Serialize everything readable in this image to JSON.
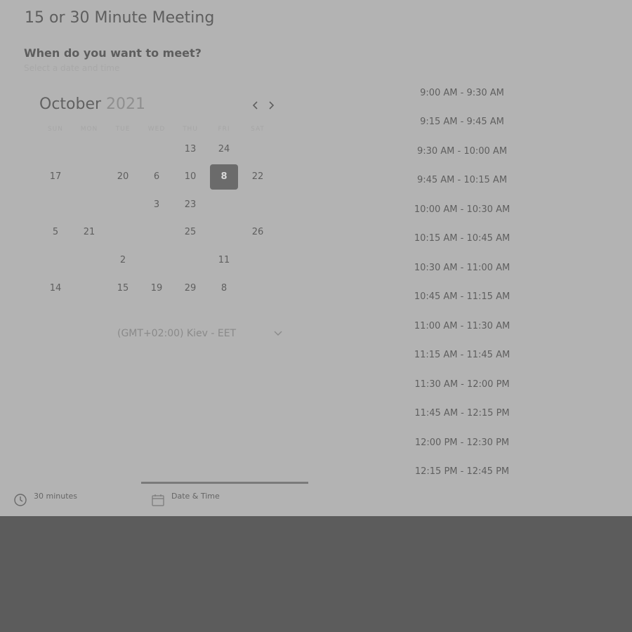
{
  "meeting": {
    "title": "15 or 30 Minute Meeting",
    "question": "When do you want to meet?",
    "hint": "Select a date and time"
  },
  "calendar": {
    "month": "October",
    "year": "2021",
    "prev_icon": "chevron-left-icon",
    "next_icon": "chevron-right-icon",
    "weekdays": [
      "SUN",
      "MON",
      "TUE",
      "WED",
      "THU",
      "FRI",
      "SAT"
    ],
    "weeks": [
      [
        {
          "t": "",
          "m": true
        },
        {
          "t": "",
          "m": true
        },
        {
          "t": "",
          "m": true
        },
        {
          "t": "",
          "m": true
        },
        {
          "t": "13",
          "m": false
        },
        {
          "t": "24",
          "m": false
        },
        {
          "t": "",
          "m": true
        }
      ],
      [
        {
          "t": "17",
          "m": false
        },
        {
          "t": "",
          "m": true
        },
        {
          "t": "20",
          "m": false
        },
        {
          "t": "6",
          "m": false
        },
        {
          "t": "10",
          "m": false
        },
        {
          "t": "8",
          "m": false,
          "selected": true
        },
        {
          "t": "22",
          "m": false
        }
      ],
      [
        {
          "t": "",
          "m": true
        },
        {
          "t": "",
          "m": true
        },
        {
          "t": "",
          "m": true
        },
        {
          "t": "3",
          "m": false
        },
        {
          "t": "23",
          "m": false
        },
        {
          "t": "",
          "m": true
        },
        {
          "t": "",
          "m": true
        }
      ],
      [
        {
          "t": "5",
          "m": false
        },
        {
          "t": "21",
          "m": false
        },
        {
          "t": "",
          "m": true
        },
        {
          "t": "",
          "m": true
        },
        {
          "t": "25",
          "m": false
        },
        {
          "t": "",
          "m": true
        },
        {
          "t": "26",
          "m": false
        }
      ],
      [
        {
          "t": "",
          "m": true
        },
        {
          "t": "",
          "m": true
        },
        {
          "t": "2",
          "m": false
        },
        {
          "t": "",
          "m": true
        },
        {
          "t": "",
          "m": true
        },
        {
          "t": "11",
          "m": false
        },
        {
          "t": "",
          "m": true
        }
      ],
      [
        {
          "t": "14",
          "m": false
        },
        {
          "t": "",
          "m": true
        },
        {
          "t": "15",
          "m": false
        },
        {
          "t": "19",
          "m": false
        },
        {
          "t": "29",
          "m": false
        },
        {
          "t": "8",
          "m": false
        },
        {
          "t": "",
          "m": true
        }
      ]
    ]
  },
  "timezone": {
    "label": "(GMT+02:00) Kiev - EET",
    "chevron_icon": "chevron-down-icon"
  },
  "time_slots": [
    "9:00 AM - 9:30 AM",
    "9:15 AM - 9:45 AM",
    "9:30 AM - 10:00 AM",
    "9:45 AM - 10:15 AM",
    "10:00 AM - 10:30 AM",
    "10:15 AM - 10:45 AM",
    "10:30 AM - 11:00 AM",
    "10:45 AM - 11:15 AM",
    "11:00 AM - 11:30 AM",
    "11:15 AM - 11:45 AM",
    "11:30 AM - 12:00 PM",
    "11:45 AM - 12:15 PM",
    "12:00 PM - 12:30 PM",
    "12:15 PM - 12:45 PM"
  ],
  "steps": {
    "duration": {
      "label": "30 minutes",
      "sub": "",
      "icon": "clock-icon"
    },
    "datetime": {
      "label": "Date & Time",
      "sub": "",
      "icon": "calendar-icon"
    }
  }
}
